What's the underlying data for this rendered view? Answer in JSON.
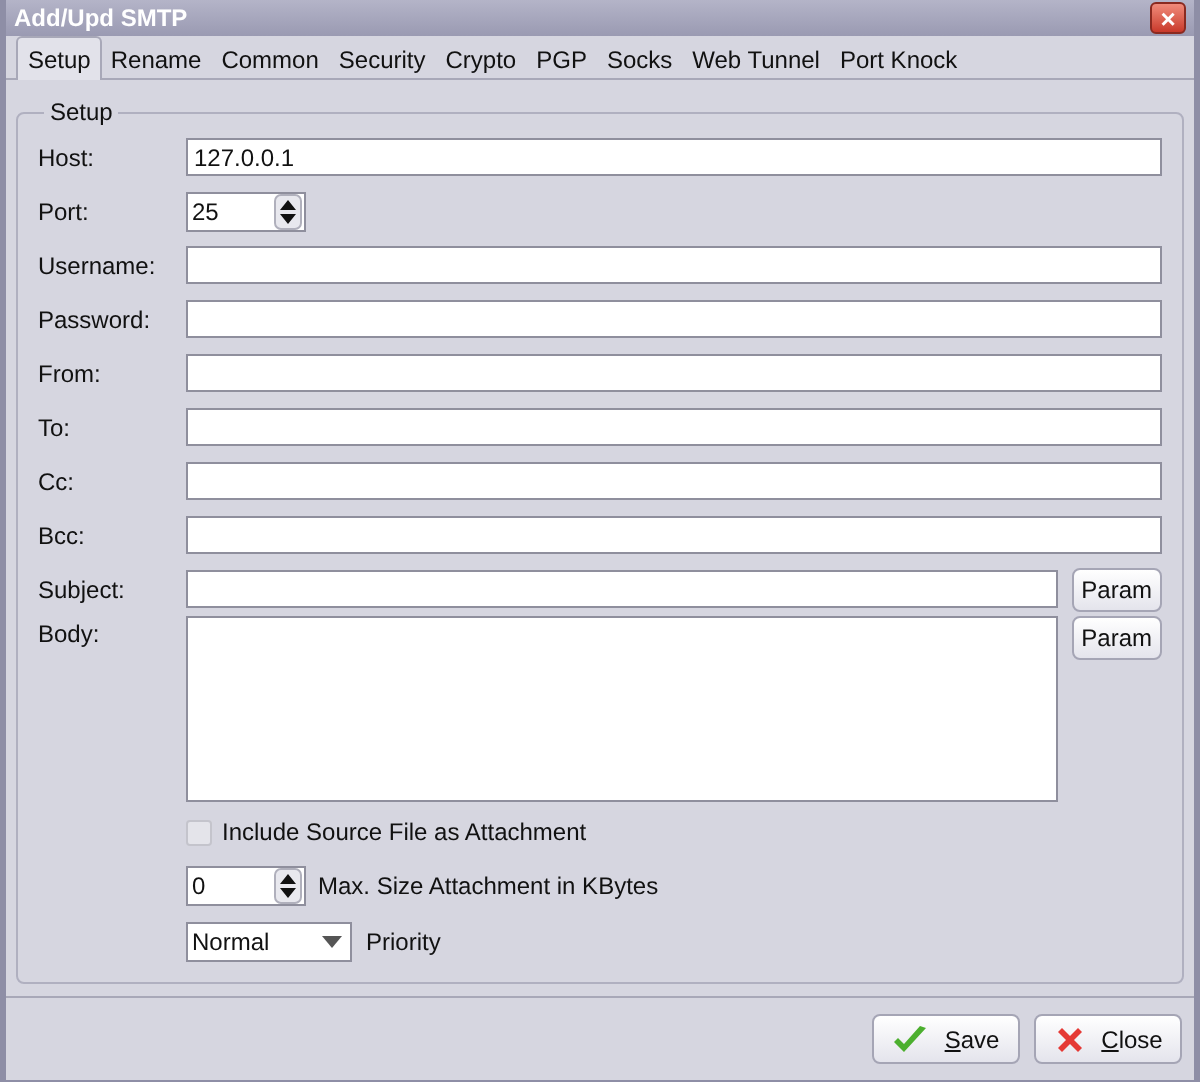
{
  "window": {
    "title": "Add/Upd SMTP",
    "close": "×"
  },
  "tabs": [
    {
      "label": "Setup",
      "selected": true
    },
    {
      "label": "Rename",
      "selected": false
    },
    {
      "label": "Common",
      "selected": false
    },
    {
      "label": "Security",
      "selected": false
    },
    {
      "label": "Crypto",
      "selected": false
    },
    {
      "label": "PGP",
      "selected": false
    },
    {
      "label": "Socks",
      "selected": false
    },
    {
      "label": "Web Tunnel",
      "selected": false
    },
    {
      "label": "Port Knock",
      "selected": false
    }
  ],
  "group": {
    "title": "Setup"
  },
  "fields": [
    {
      "kind": "text",
      "label": "Host:",
      "value": "127.0.0.1"
    },
    {
      "kind": "spin",
      "label": "Port:",
      "value": "25"
    },
    {
      "kind": "text",
      "label": "Username:"
    },
    {
      "kind": "text",
      "label": "Password:"
    },
    {
      "kind": "text",
      "label": "From:"
    },
    {
      "kind": "text",
      "label": "To:"
    },
    {
      "kind": "text",
      "label": "Cc:"
    },
    {
      "kind": "text",
      "label": "Bcc:"
    },
    {
      "kind": "param",
      "label": "Subject:",
      "button": "Param"
    },
    {
      "kind": "memo",
      "label": "Body:",
      "button": "Param"
    }
  ],
  "attachment": {
    "label": "Include Source File as Attachment",
    "checked": false,
    "disabled": true
  },
  "max_size": {
    "value": "0",
    "label": "Max. Size Attachment in KBytes"
  },
  "priority": {
    "value": "Normal",
    "label": "Priority"
  },
  "buttons": [
    {
      "kind": "save",
      "label": "Save",
      "mnemonic": true
    },
    {
      "kind": "close",
      "label": "Close",
      "mnemonic": true
    }
  ]
}
